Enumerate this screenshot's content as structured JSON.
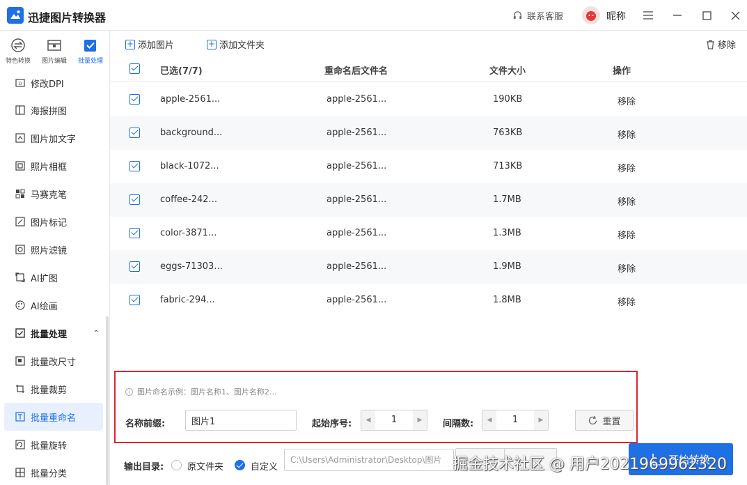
{
  "app": {
    "title": "迅捷图片转换器",
    "support": "联系客服",
    "nickname": "昵称"
  },
  "topnav": [
    {
      "label": "特色转换"
    },
    {
      "label": "图片编辑"
    },
    {
      "label": "批量处理"
    }
  ],
  "sidebar": {
    "items": [
      {
        "label": "修改DPI"
      },
      {
        "label": "海报拼图"
      },
      {
        "label": "图片加文字"
      },
      {
        "label": "照片相框"
      },
      {
        "label": "马赛克笔"
      },
      {
        "label": "图片标记"
      },
      {
        "label": "照片滤镜"
      },
      {
        "label": "AI扩图"
      },
      {
        "label": "AI绘画"
      },
      {
        "label": "批量处理"
      },
      {
        "label": "批量改尺寸"
      },
      {
        "label": "批量裁剪"
      },
      {
        "label": "批量重命名"
      },
      {
        "label": "批量旋转"
      },
      {
        "label": "批量分类"
      }
    ]
  },
  "toolbar": {
    "add_image": "添加图片",
    "add_folder": "添加文件夹",
    "remove_all": "移除"
  },
  "table": {
    "headers": {
      "selected": "已选(7/7)",
      "renamed": "重命名后文件名",
      "size": "文件大小",
      "action": "操作"
    },
    "rows": [
      {
        "name": "apple-2561...",
        "renamed": "apple-2561...",
        "size": "190KB",
        "action": "移除"
      },
      {
        "name": "background...",
        "renamed": "apple-2561...",
        "size": "763KB",
        "action": "移除"
      },
      {
        "name": "black-1072...",
        "renamed": "apple-2561...",
        "size": "713KB",
        "action": "移除"
      },
      {
        "name": "coffee-242...",
        "renamed": "apple-2561...",
        "size": "1.7MB",
        "action": "移除"
      },
      {
        "name": "color-3871...",
        "renamed": "apple-2561...",
        "size": "1.3MB",
        "action": "移除"
      },
      {
        "name": "eggs-71303...",
        "renamed": "apple-2561...",
        "size": "1.9MB",
        "action": "移除"
      },
      {
        "name": "fabric-294...",
        "renamed": "apple-2561...",
        "size": "1.8MB",
        "action": "移除"
      }
    ]
  },
  "naming": {
    "hint": "图片命名示例：图片名称1、图片名称2...",
    "prefix_label": "名称前缀:",
    "prefix_value": "图片1",
    "start_label": "起始序号:",
    "start_value": "1",
    "step_label": "间隔数:",
    "step_value": "1",
    "reset": "重置"
  },
  "output": {
    "label": "输出目录:",
    "option_original": "原文件夹",
    "option_custom": "自定义",
    "path": "C:\\Users\\Administrator\\Desktop\\图片",
    "start_button": "开始转换"
  },
  "watermark": "掘金技术社区 @ 用户2021969962320",
  "colors": {
    "accent": "#1f6fe5",
    "highlight_border": "#e0242d"
  }
}
